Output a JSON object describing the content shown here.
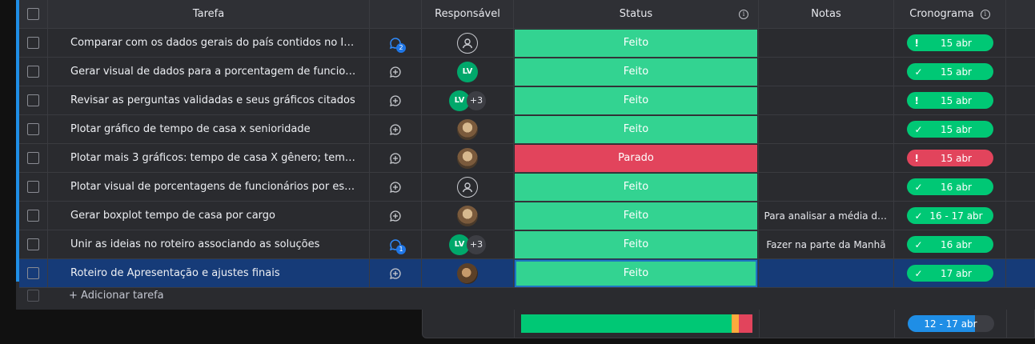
{
  "header": {
    "task": "Tarefa",
    "responsible": "Responsável",
    "status": "Status",
    "notes": "Notas",
    "timeline": "Cronograma"
  },
  "colors": {
    "feito": "#33d391",
    "parado": "#e2445c",
    "timeline_green": "#00c875",
    "selected_row": "#163b78"
  },
  "rows": [
    {
      "task": "Comparar com os dados gerais do país contidos no IBG...",
      "update_count": "2",
      "responsible": "empty",
      "status": "Feito",
      "notes": "",
      "tl_icon": "!",
      "timeline": "15 abr",
      "tl_color": "green"
    },
    {
      "task": "Gerar visual de dados para a porcentagem de funcionári...",
      "update_count": "",
      "responsible": "LV",
      "status": "Feito",
      "notes": "",
      "tl_icon": "✓",
      "timeline": "15 abr",
      "tl_color": "green"
    },
    {
      "task": "Revisar as perguntas validadas e seus gráficos citados",
      "update_count": "",
      "responsible": "LV",
      "extra": "+3",
      "status": "Feito",
      "notes": "",
      "tl_icon": "!",
      "timeline": "15 abr",
      "tl_color": "green"
    },
    {
      "task": "Plotar gráfico de tempo de casa x senioridade",
      "update_count": "",
      "responsible": "photo",
      "status": "Feito",
      "notes": "",
      "tl_icon": "✓",
      "timeline": "15 abr",
      "tl_color": "green"
    },
    {
      "task": "Plotar mais 3 gráficos: tempo de casa X gênero; tempo ...",
      "update_count": "",
      "responsible": "photo",
      "status": "Parado",
      "notes": "",
      "tl_icon": "!",
      "timeline": "15 abr",
      "tl_color": "red"
    },
    {
      "task": "Plotar visual de porcentagens de funcionários por estado",
      "update_count": "",
      "responsible": "empty",
      "status": "Feito",
      "notes": "",
      "tl_icon": "✓",
      "timeline": "16 abr",
      "tl_color": "green"
    },
    {
      "task": "Gerar boxplot tempo de casa por cargo",
      "update_count": "",
      "responsible": "photo",
      "status": "Feito",
      "notes": "Para analisar a média de ...",
      "tl_icon": "✓",
      "timeline": "16 - 17 abr",
      "tl_color": "green"
    },
    {
      "task": "Unir as ideias no roteiro associando as soluções",
      "update_count": "1",
      "responsible": "LV",
      "extra": "+3",
      "status": "Feito",
      "notes": "Fazer na parte da Manhã",
      "tl_icon": "✓",
      "timeline": "16 abr",
      "tl_color": "green"
    },
    {
      "task": "Roteiro de Apresentação e ajustes finais",
      "update_count": "",
      "responsible": "photo2",
      "status": "Feito",
      "notes": "",
      "tl_icon": "✓",
      "timeline": "17 abr",
      "tl_color": "green",
      "selected": true
    }
  ],
  "add_task": "+ Adicionar tarefa",
  "summary": {
    "status_distribution": {
      "Feito": 0.91,
      "Working": 0.03,
      "Parado": 0.06
    },
    "timeline": "12 - 17 abr",
    "timeline_progress": 0.78
  }
}
